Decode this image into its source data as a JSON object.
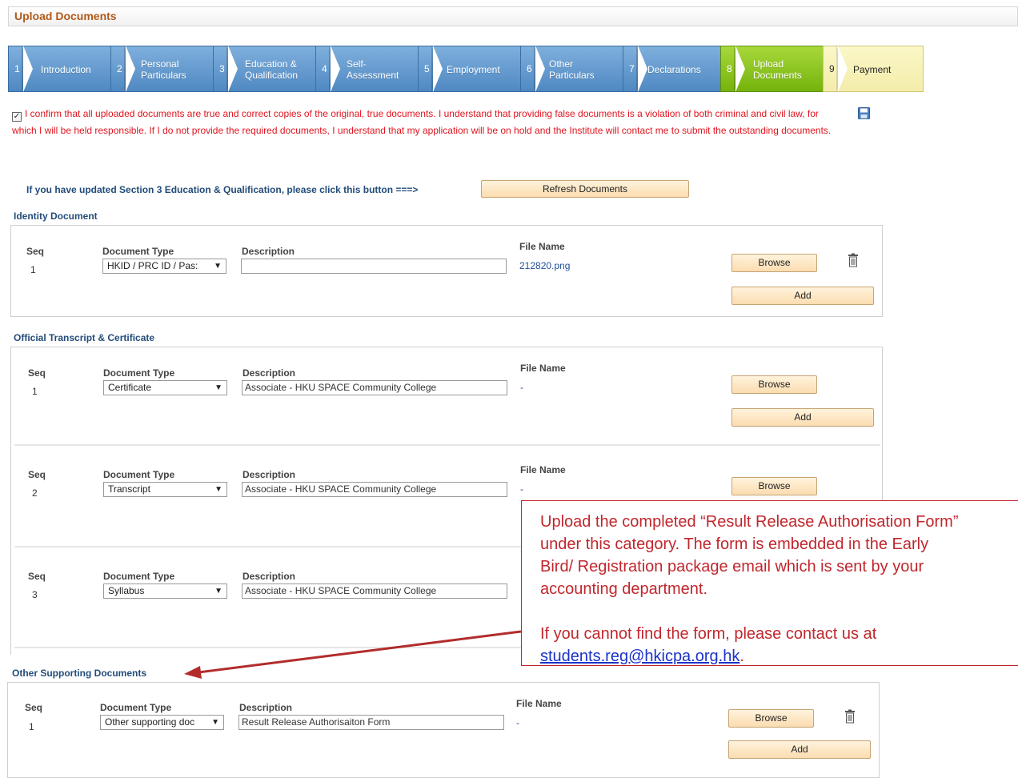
{
  "page": {
    "title": "Upload Documents"
  },
  "steps": [
    {
      "num": "1",
      "label": "Introduction"
    },
    {
      "num": "2",
      "label": "Personal Particulars"
    },
    {
      "num": "3",
      "label": "Education & Qualification"
    },
    {
      "num": "4",
      "label": "Self-Assessment"
    },
    {
      "num": "5",
      "label": "Employment"
    },
    {
      "num": "6",
      "label": "Other Particulars"
    },
    {
      "num": "7",
      "label": "Declarations"
    },
    {
      "num": "8",
      "label": "Upload Documents"
    },
    {
      "num": "9",
      "label": "Payment"
    }
  ],
  "confirm": {
    "checked": true,
    "text": "I confirm that all uploaded documents are true and correct copies of the original, true documents.  I understand that providing false documents is a violation of both criminal and civil law, for which I will be held responsible.  If I do not provide the required documents, I understand that my application will be on hold and the Institute will contact me to submit the outstanding documents."
  },
  "refresh": {
    "prompt": "If you have updated Section 3 Education & Qualification, please click this button ===>",
    "button": "Refresh Documents"
  },
  "labels": {
    "seq": "Seq",
    "doc_type": "Document Type",
    "description": "Description",
    "file_name": "File Name",
    "browse": "Browse",
    "add": "Add"
  },
  "identity": {
    "title": "Identity Document",
    "row": {
      "seq": "1",
      "type": "HKID / PRC ID / Pas:",
      "description": "",
      "file": "212820.png"
    }
  },
  "official": {
    "title": "Official Transcript & Certificate",
    "rows": [
      {
        "seq": "1",
        "type": "Certificate",
        "description": "Associate - HKU SPACE Community College",
        "file": "-"
      },
      {
        "seq": "2",
        "type": "Transcript",
        "description": "Associate - HKU SPACE Community College",
        "file": "-"
      },
      {
        "seq": "3",
        "type": "Syllabus",
        "description": "Associate - HKU SPACE Community College",
        "file": ""
      }
    ]
  },
  "other": {
    "title": "Other Supporting Documents",
    "row": {
      "seq": "1",
      "type": "Other supporting doc",
      "description": "Result Release Authorisaiton Form",
      "file": "-"
    }
  },
  "callout": {
    "line1": "Upload the completed “Result Release Authorisation Form”",
    "line2": "under this category.  The form is embedded in the Early",
    "line3": "Bird/ Registration package email which is sent by your",
    "line4": "accounting department.",
    "line5": "If you cannot find the form, please contact us at",
    "email": "students.reg@hkicpa.org.hk",
    "period": "."
  },
  "colors": {
    "accent": "#c0272d",
    "step_done": "#5b93cb",
    "step_active": "#8cc21c",
    "step_next": "#f6f1b8"
  }
}
